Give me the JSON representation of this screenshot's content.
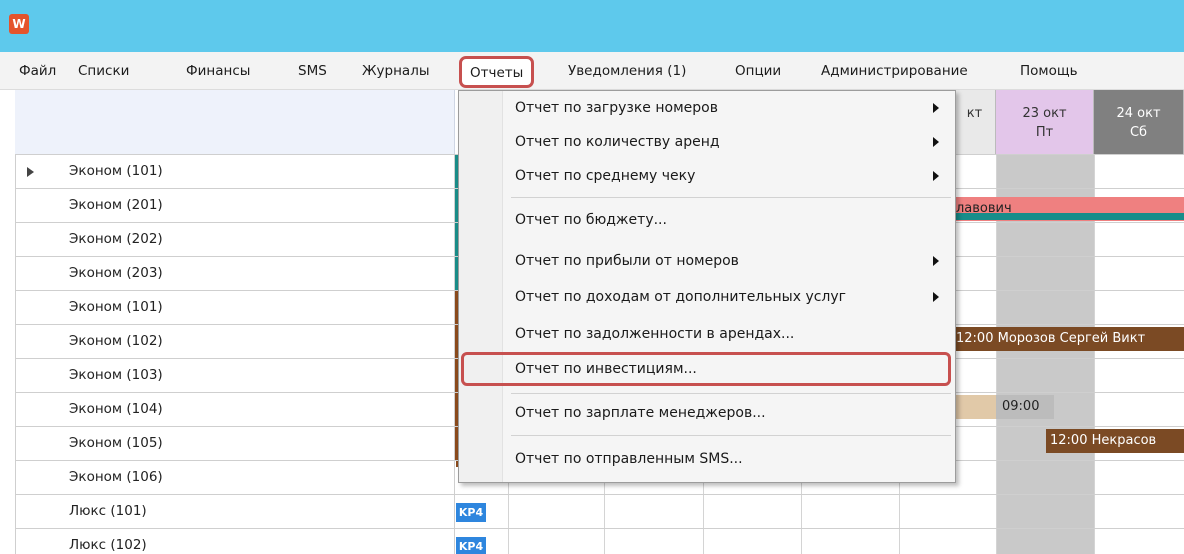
{
  "window": {
    "app_icon_letter": "W",
    "titlebar_color": "#5ec9ec"
  },
  "menubar": {
    "items": [
      {
        "label": "Файл"
      },
      {
        "label": "Списки"
      },
      {
        "label": "Финансы"
      },
      {
        "label": "SMS"
      },
      {
        "label": "Журналы"
      },
      {
        "label": "Отчеты",
        "active": true
      },
      {
        "label": "Уведомления (1)"
      },
      {
        "label": "Опции"
      },
      {
        "label": "Администрирование"
      },
      {
        "label": "Помощь"
      }
    ]
  },
  "calendar": {
    "days": [
      {
        "label": "кт",
        "weekday": ""
      },
      {
        "label": "23 окт",
        "weekday": "Пт"
      },
      {
        "label": "24 окт",
        "weekday": "Сб"
      }
    ],
    "rooms": [
      {
        "label": "Эконом (101)",
        "current": true
      },
      {
        "label": "Эконом (201)"
      },
      {
        "label": "Эконом (202)"
      },
      {
        "label": "Эконом (203)"
      },
      {
        "label": "Эконом (101)"
      },
      {
        "label": "Эконом (102)"
      },
      {
        "label": "Эконом (103)"
      },
      {
        "label": "Эконом (104)"
      },
      {
        "label": "Эконом (105)"
      },
      {
        "label": "Эконом (106)"
      },
      {
        "label": "Люкс (101)",
        "badge": "KP4"
      },
      {
        "label": "Люкс (102)",
        "badge": "KP4"
      }
    ],
    "bookings": [
      {
        "text": "лавович",
        "color": "#ef8080"
      },
      {
        "text": "12:00 Морозов Сергей Викт",
        "color": "#7b4a24"
      },
      {
        "text": "",
        "color": "#e1c9a8"
      },
      {
        "text": "09:00",
        "color": "#bcbcbc"
      },
      {
        "text": "12:00 Некрасов",
        "color": "#7b4a24"
      }
    ]
  },
  "reports_menu": {
    "items": [
      {
        "label": "Отчет по загрузке номеров",
        "submenu": true
      },
      {
        "label": "Отчет по количеству аренд",
        "submenu": true
      },
      {
        "label": "Отчет по среднему чеку",
        "submenu": true
      },
      {
        "label": "Отчет по бюджету..."
      },
      {
        "label": "Отчет по прибыли от номеров",
        "submenu": true
      },
      {
        "label": "Отчет по доходам от дополнительных услуг",
        "submenu": true
      },
      {
        "label": "Отчет по задолженности в арендах..."
      },
      {
        "label": "Отчет по инвестициям...",
        "highlighted": true
      },
      {
        "label": "Отчет по зарплате менеджеров..."
      },
      {
        "label": "Отчет по отправленным SMS..."
      }
    ]
  },
  "colors": {
    "highlight_outline": "#c7504f",
    "teal": "#1a8c88",
    "brown": "#8a4a1c",
    "badge_blue": "#2e86de",
    "weekend_header": "#808080",
    "friday_header": "#e3c6ea"
  }
}
